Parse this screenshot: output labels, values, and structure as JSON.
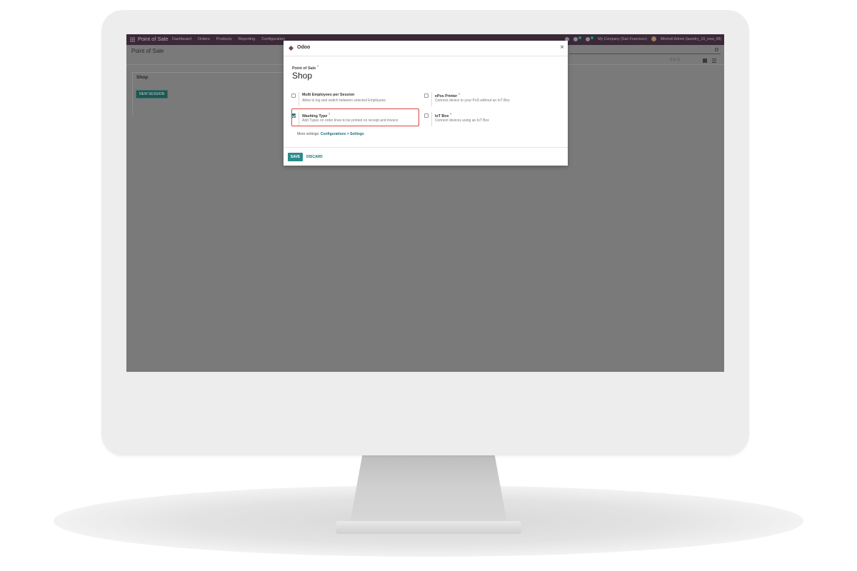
{
  "topbar": {
    "app_name": "Point of Sale",
    "menu": [
      "Dashboard",
      "Orders",
      "Products",
      "Reporting",
      "Configuration"
    ],
    "company": "My Company (San Francisco)",
    "user": "Mitchell Admin (laundry_16_new_08)"
  },
  "page": {
    "title": "Point of Sale",
    "pager": "1-1 / 1"
  },
  "kanban": {
    "card_title": "Shop",
    "new_session_label": "NEW SESSION"
  },
  "modal": {
    "title": "Odoo",
    "field_label": "Point of Sale",
    "field_label_help": "?",
    "record_name": "Shop",
    "settings": [
      {
        "title": "Multi Employees per Session",
        "help": "",
        "description": "Allow to log and switch between selected Employees",
        "checked": false
      },
      {
        "title": "ePos Printer",
        "help": "?",
        "description": "Connect device to your PoS without an IoT Box",
        "checked": false
      },
      {
        "title": "Washing Type",
        "help": "?",
        "description": "Add Types on order lines to be printed on receipt and invoice",
        "checked": true
      },
      {
        "title": "IoT Box",
        "help": "?",
        "description": "Connect devices using an IoT Box",
        "checked": false
      }
    ],
    "more_settings_prefix": "More settings:",
    "more_settings_link": "Configurations > Settings",
    "save_label": "SAVE",
    "discard_label": "DISCARD"
  },
  "colors": {
    "topbar": "#3a2938",
    "primary": "#2c8b8c",
    "highlight": "#e0443e",
    "overlay": "#7a7a7a"
  }
}
